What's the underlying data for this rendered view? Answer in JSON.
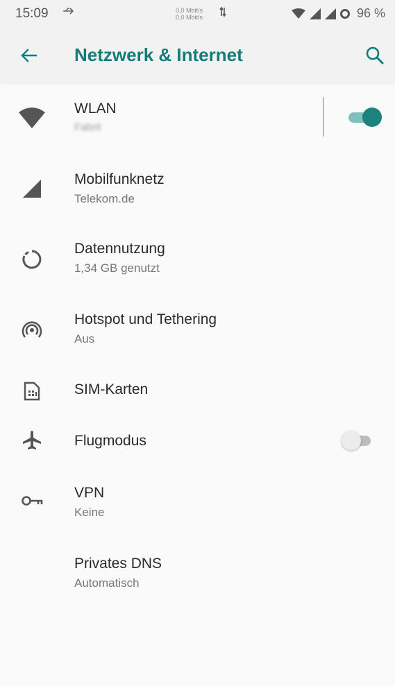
{
  "status_bar": {
    "time": "15:09",
    "speed_up": "0,0 Mbit/s",
    "speed_down": "0,0 Mbit/s",
    "battery": "96 %"
  },
  "app_bar": {
    "title": "Netzwerk & Internet",
    "accent_color": "#147d7a"
  },
  "items": [
    {
      "title": "WLAN",
      "subtitle": "Fabrit",
      "icon": "wifi-icon",
      "toggle": true
    },
    {
      "title": "Mobilfunknetz",
      "subtitle": "Telekom.de",
      "icon": "signal-icon"
    },
    {
      "title": "Datennutzung",
      "subtitle": "1,34 GB genutzt",
      "icon": "data-usage-icon"
    },
    {
      "title": "Hotspot und Tethering",
      "subtitle": "Aus",
      "icon": "hotspot-icon"
    },
    {
      "title": "SIM-Karten",
      "icon": "sim-card-icon"
    },
    {
      "title": "Flugmodus",
      "icon": "airplane-icon",
      "toggle": false
    },
    {
      "title": "VPN",
      "subtitle": "Keine",
      "icon": "vpn-key-icon"
    },
    {
      "title": "Privates DNS",
      "subtitle": "Automatisch"
    }
  ]
}
